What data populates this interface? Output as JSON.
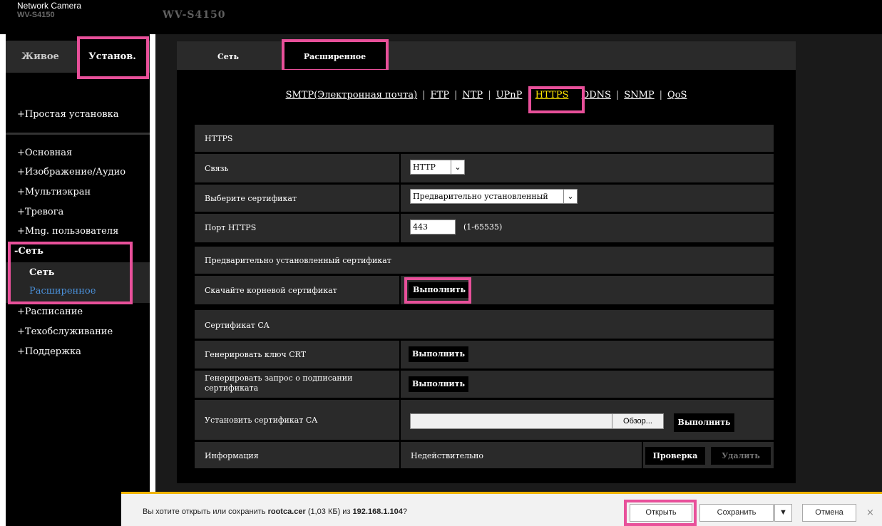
{
  "header": {
    "brand": "Network Camera",
    "brand_model": "WV-S4150",
    "model_title": "WV-S4150"
  },
  "left_tabs": {
    "live": "Живое",
    "setup": "Установ."
  },
  "sidebar": {
    "items": [
      "+Простая установка",
      "+Основная",
      "+Изображение/Аудио",
      "+Мультиэкран",
      "+Тревога",
      "+Mng. пользователя",
      "-Сеть",
      "Сеть",
      "Расширенное",
      "+Расписание",
      "+Техобслуживание",
      "+Поддержка"
    ]
  },
  "main_tabs": {
    "network": "Сеть",
    "advanced": "Расширенное"
  },
  "subnav": {
    "smtp": "SMTP(Электронная почта)",
    "ftp": "FTP",
    "ntp": "NTP",
    "upnp": "UPnP",
    "https": "HTTPS",
    "ddns": "DDNS",
    "snmp": "SNMP",
    "qos": "QoS",
    "separator": "|"
  },
  "https": {
    "section_title": "HTTPS",
    "connection_label": "Связь",
    "connection_value": "HTTP",
    "cert_select_label": "Выберите сертификат",
    "cert_select_value": "Предварительно установленный",
    "port_label": "Порт HTTPS",
    "port_value": "443",
    "port_range": "(1-65535)"
  },
  "preinstalled": {
    "section_title": "Предварительно установленный сертификат",
    "download_root_label": "Скачайте корневой сертификат",
    "execute": "Выполнить"
  },
  "ca": {
    "section_title": "Сертификат CA",
    "gen_key_label": "Генерировать ключ CRT",
    "gen_csr_label_1": "Генерировать запрос о подписании",
    "gen_csr_label_2": "сертификата",
    "install_label": "Установить сертификат CA",
    "browse": "Обзор...",
    "info_label": "Информация",
    "info_value": "Недействительно",
    "check": "Проверка",
    "delete": "Удалить",
    "execute": "Выполнить"
  },
  "download_bar": {
    "prompt_prefix": "Вы хотите открыть или сохранить ",
    "filename": "rootca.cer",
    "size": " (1,03 КБ) из ",
    "host": "192.168.1.104",
    "suffix": "?",
    "open": "Открыть",
    "save": "Сохранить",
    "cancel": "Отмена",
    "close_glyph": "×"
  },
  "colors": {
    "highlight": "#e8509a",
    "active_subnav": "#ffe600",
    "active_sidebar": "#4a90d9",
    "download_accent": "#f0b400"
  }
}
